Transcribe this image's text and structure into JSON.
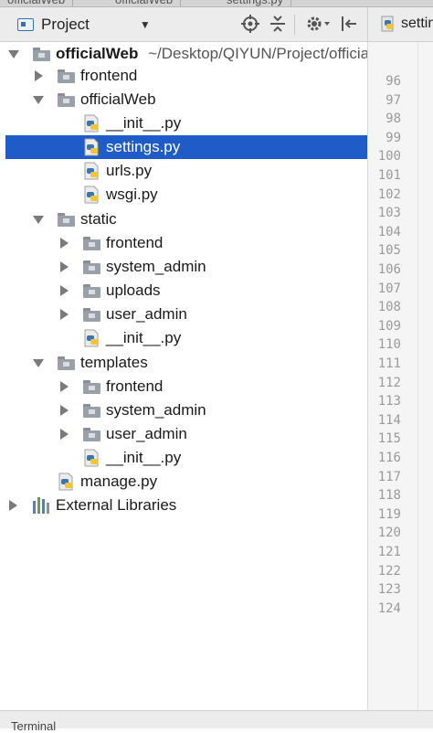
{
  "editor_tabs": [
    "officialWeb",
    "officialWeb",
    "settings.py"
  ],
  "project_panel": {
    "view_label": "Project",
    "dropdown_icon": "caret-down-icon",
    "toolbar_icons": [
      "locate-crosshair-icon",
      "collapse-all-icon",
      "gear-icon",
      "hide-panel-icon"
    ]
  },
  "editor": {
    "tab_label": "settings.py",
    "line_numbers": [
      "96",
      "97",
      "98",
      "99",
      "100",
      "101",
      "102",
      "103",
      "104",
      "105",
      "106",
      "107",
      "108",
      "109",
      "110",
      "111",
      "112",
      "113",
      "114",
      "115",
      "116",
      "117",
      "118",
      "119",
      "120",
      "121",
      "122",
      "123",
      "124"
    ]
  },
  "tree": [
    {
      "label": "officialWeb",
      "suffix": "~/Desktop/QIYUN/Project/officialWeb",
      "type": "folder",
      "expanded": true,
      "bold": true
    },
    {
      "label": "frontend",
      "type": "folder",
      "expanded": false
    },
    {
      "label": "officialWeb",
      "type": "folder",
      "expanded": true
    },
    {
      "label": "__init__.py",
      "type": "python"
    },
    {
      "label": "settings.py",
      "type": "python",
      "selected": true
    },
    {
      "label": "urls.py",
      "type": "python"
    },
    {
      "label": "wsgi.py",
      "type": "python"
    },
    {
      "label": "static",
      "type": "folder",
      "expanded": true
    },
    {
      "label": "frontend",
      "type": "folder",
      "expanded": false
    },
    {
      "label": "system_admin",
      "type": "folder",
      "expanded": false
    },
    {
      "label": "uploads",
      "type": "folder",
      "expanded": false
    },
    {
      "label": "user_admin",
      "type": "folder",
      "expanded": false
    },
    {
      "label": "__init__.py",
      "type": "python"
    },
    {
      "label": "templates",
      "type": "folder",
      "expanded": true
    },
    {
      "label": "frontend",
      "type": "folder",
      "expanded": false
    },
    {
      "label": "system_admin",
      "type": "folder",
      "expanded": false
    },
    {
      "label": "user_admin",
      "type": "folder",
      "expanded": false
    },
    {
      "label": "__init__.py",
      "type": "python"
    },
    {
      "label": "manage.py",
      "type": "python"
    },
    {
      "label": "External Libraries",
      "type": "libraries",
      "expanded": false
    }
  ],
  "bottom_bar": {
    "label": "Terminal"
  },
  "colors": {
    "selection": "#1f5cc8",
    "folder": "#9aa0a8",
    "python_blue": "#3a75b0",
    "python_yellow": "#f2c633"
  }
}
